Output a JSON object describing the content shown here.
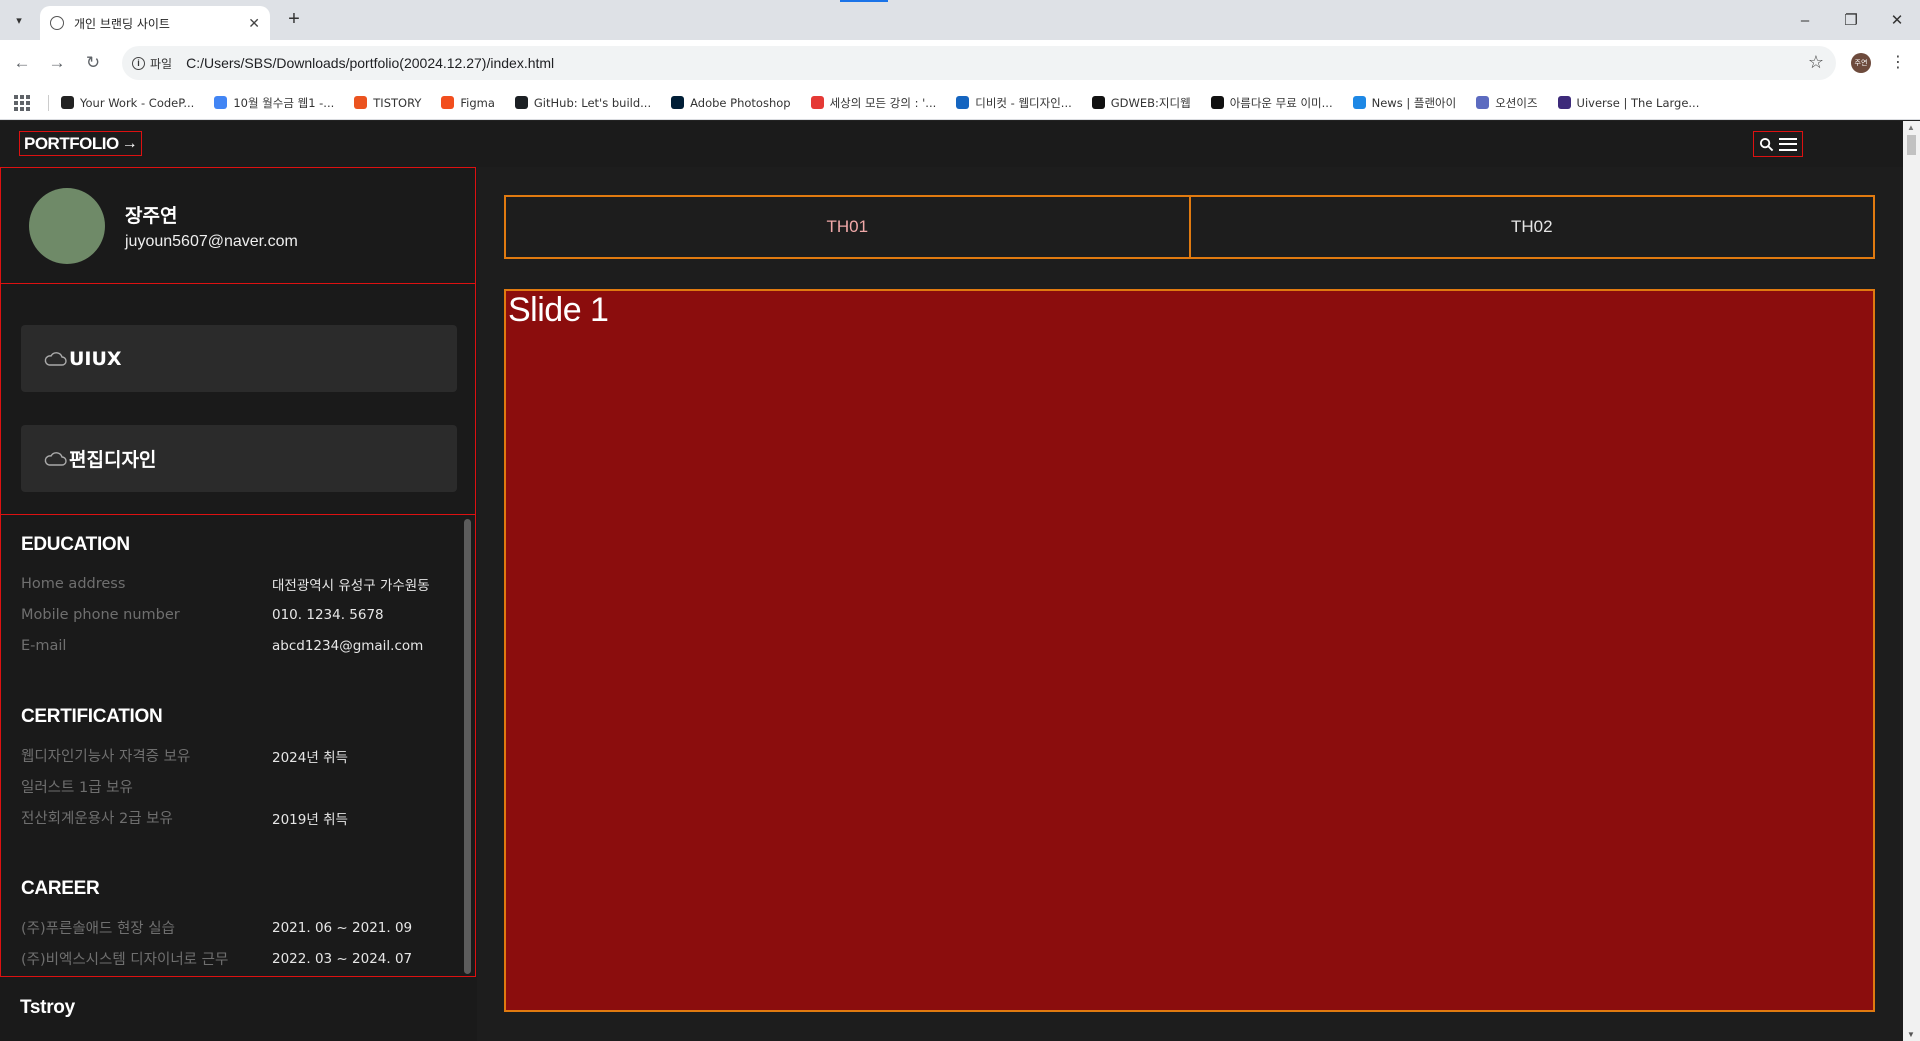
{
  "browser": {
    "tab_title": "개인 브랜딩 사이트",
    "tab_close": "✕",
    "new_tab": "+",
    "url": "C:/Users/SBS/Downloads/portfolio(20024.12.27)/index.html",
    "url_chip": "파일",
    "profile_initials": "주연",
    "window_controls": [
      "–",
      "❐",
      "✕"
    ],
    "bookmarks": [
      {
        "label": "Your Work - CodeP...",
        "icon": "codepen-icon",
        "color": "#222222"
      },
      {
        "label": "10월 월수금 웹1 -...",
        "icon": "docs-icon",
        "color": "#4285f4"
      },
      {
        "label": "TISTORY",
        "icon": "tistory-icon",
        "color": "#eb531f"
      },
      {
        "label": "Figma",
        "icon": "figma-icon",
        "color": "#f24e1e"
      },
      {
        "label": "GitHub: Let's build...",
        "icon": "github-icon",
        "color": "#1b1f23"
      },
      {
        "label": "Adobe Photoshop",
        "icon": "photoshop-icon",
        "color": "#001e36"
      },
      {
        "label": "세상의 모든 강의 : '...",
        "icon": "play-icon",
        "color": "#e53935"
      },
      {
        "label": "디비컷 - 웹디자인...",
        "icon": "dbcut-icon",
        "color": "#1565c0"
      },
      {
        "label": "GDWEB:지디웹",
        "icon": "gdweb-icon",
        "color": "#111111"
      },
      {
        "label": "아름다운 무료 이미...",
        "icon": "unsplash-icon",
        "color": "#111111"
      },
      {
        "label": "News | 플랜아이",
        "icon": "info-icon",
        "color": "#1e88e5"
      },
      {
        "label": "오션이즈",
        "icon": "oceanis-icon",
        "color": "#5c6bc0"
      },
      {
        "label": "Uiverse | The Large...",
        "icon": "uiverse-icon",
        "color": "#3d2a7a"
      }
    ]
  },
  "header": {
    "logo": "PORTFOLIO",
    "logo_arrow": "→"
  },
  "profile": {
    "name": "장주연",
    "email": "juyoun5607@naver.com"
  },
  "categories": [
    {
      "label": "UIUX",
      "icon": "cloud-icon"
    },
    {
      "label": "편집디자인",
      "icon": "cloud-icon"
    }
  ],
  "education": {
    "title": "EDUCATION",
    "rows": [
      {
        "k": "Home address",
        "v": "대전광역시 유성구 가수원동"
      },
      {
        "k": "Mobile phone number",
        "v": "010. 1234. 5678"
      },
      {
        "k": "E-mail",
        "v": "abcd1234@gmail.com"
      }
    ]
  },
  "certification": {
    "title": "CERTIFICATION",
    "rows": [
      {
        "k": "웹디자인기능사 자격증 보유",
        "v": "2024년 취득"
      },
      {
        "k": "일러스트 1급 보유",
        "v": ""
      },
      {
        "k": "전산회계운용사 2급 보유",
        "v": "2019년 취득"
      }
    ]
  },
  "career": {
    "title": "CAREER",
    "rows": [
      {
        "k": "(주)푸른솔애드 현장 실습",
        "v": "2021. 06 ~ 2021. 09"
      },
      {
        "k": "(주)비엑스시스템 디자이너로 근무",
        "v": "2022. 03 ~ 2024. 07"
      }
    ]
  },
  "footer_section": "Tstroy",
  "tabs": [
    "TH01",
    "TH02"
  ],
  "slide": {
    "title": "Slide 1"
  },
  "colors": {
    "accent_border": "#dd1111",
    "tab_border": "#e07a10",
    "slide_bg": "#8b0d0d"
  }
}
